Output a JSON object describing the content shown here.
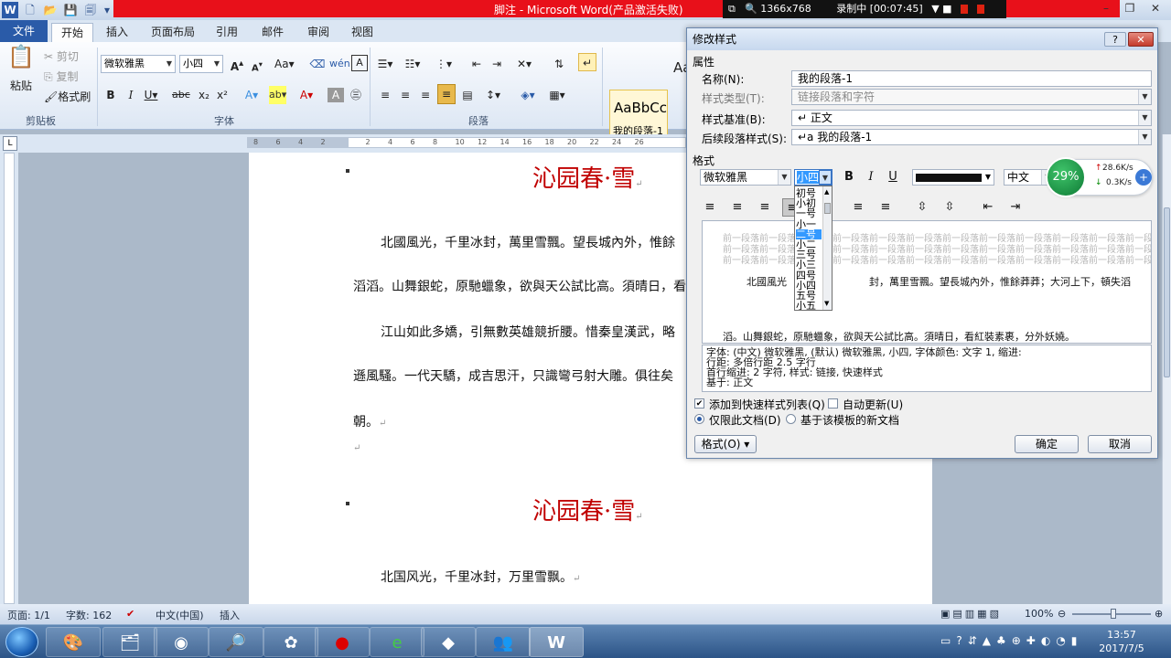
{
  "titlebar": {
    "title": "脚注 - Microsoft Word(产品激活失败)",
    "word_icon": "W",
    "resolution": "1366x768",
    "recording": "录制中",
    "rec_time": "[00:07:45]"
  },
  "tabs": [
    "文件",
    "开始",
    "插入",
    "页面布局",
    "引用",
    "邮件",
    "审阅",
    "视图"
  ],
  "ribbon": {
    "clipboard": {
      "paste": "粘贴",
      "cut": "剪切",
      "copy": "复制",
      "format_painter": "格式刷",
      "group": "剪贴板"
    },
    "font": {
      "name": "微软雅黑",
      "size": "小四",
      "group": "字体"
    },
    "paragraph": {
      "group": "段落"
    },
    "styles": {
      "preview": "AaBbCc",
      "name": "我的段落-1",
      "next_preview": "Aa"
    }
  },
  "ruler": {
    "ticks": [
      "8",
      "6",
      "4",
      "2",
      "",
      "2",
      "4",
      "6",
      "8",
      "10",
      "12",
      "14",
      "16",
      "18",
      "20",
      "22",
      "24",
      "26"
    ]
  },
  "document": {
    "title1": "沁园春·雪",
    "p1": "北國風光，千里冰封，萬里雪飄。望長城內外，惟餘",
    "p2": "滔滔。山舞銀蛇，原馳蠟象，欲與天公試比高。須晴日，看",
    "p3": "江山如此多嬌，引無數英雄競折腰。惜秦皇漢武，略",
    "p4": "遜風騷。一代天驕，成吉思汗，只識彎弓射大雕。俱往矣",
    "p5": "朝。",
    "title2": "沁园春·雪",
    "p6": "北国风光，千里冰封，万里雪飘。",
    "para_mark": "↵"
  },
  "status": {
    "page": "页面: 1/1",
    "words": "字数: 162",
    "lang": "中文(中国)",
    "mode": "插入",
    "zoom": "100%"
  },
  "taskbar": {
    "time": "13:57",
    "date": "2017/7/5"
  },
  "dialog": {
    "title": "修改样式",
    "help": "?",
    "close": "✕",
    "properties": "属性",
    "name_label": "名称(N):",
    "name_value": "我的段落-1",
    "type_label": "样式类型(T):",
    "type_value": "链接段落和字符",
    "based_label": "样式基准(B):",
    "based_value": "↵ 正文",
    "next_label": "后续段落样式(S):",
    "next_value": "↵a 我的段落-1",
    "format": "格式",
    "font_name": "微软雅黑",
    "font_size": "小四",
    "script": "中文",
    "preview_gray": "前一段落前一段落前一段落前一段落前一段落前一段落前一段落前一段落前一段落前一段落前一段落前一段落前一段落前一段落",
    "preview_line1": "北國風光",
    "preview_line1b": "封，萬里雪飄。望長城內外，惟餘莽莽；大河上下，頓失滔",
    "preview_line2": "滔。山舞銀蛇，原馳蠟象，欲與天公試比高。須晴日，看紅裝素裹，分外妖嬈。",
    "desc1": "字体: (中文) 微软雅黑, (默认) 微软雅黑, 小四, 字体颜色: 文字 1, 缩进:",
    "desc2": "    行距: 多倍行距 2.5 字行",
    "desc3": "    首行缩进:  2 字符, 样式: 链接, 快速样式",
    "desc4": "    基于: 正文",
    "add_quick": "添加到快速样式列表(Q)",
    "auto_update": "自动更新(U)",
    "this_doc": "仅限此文档(D)",
    "new_docs": "基于该模板的新文档",
    "format_btn": "格式(O) ▾",
    "ok": "确定",
    "cancel": "取消",
    "size_options": [
      "初号",
      "小初",
      "一号",
      "小一",
      "二号",
      "小二",
      "三号",
      "小三",
      "四号",
      "小四",
      "五号",
      "小五"
    ],
    "selected_size": "二号"
  },
  "net": {
    "percent": "29%",
    "up": "28.6K/s",
    "down": "0.3K/s"
  },
  "colors": {
    "title_red": "#c00000",
    "accent": "#2a5ba8",
    "select": "#3399ff"
  }
}
